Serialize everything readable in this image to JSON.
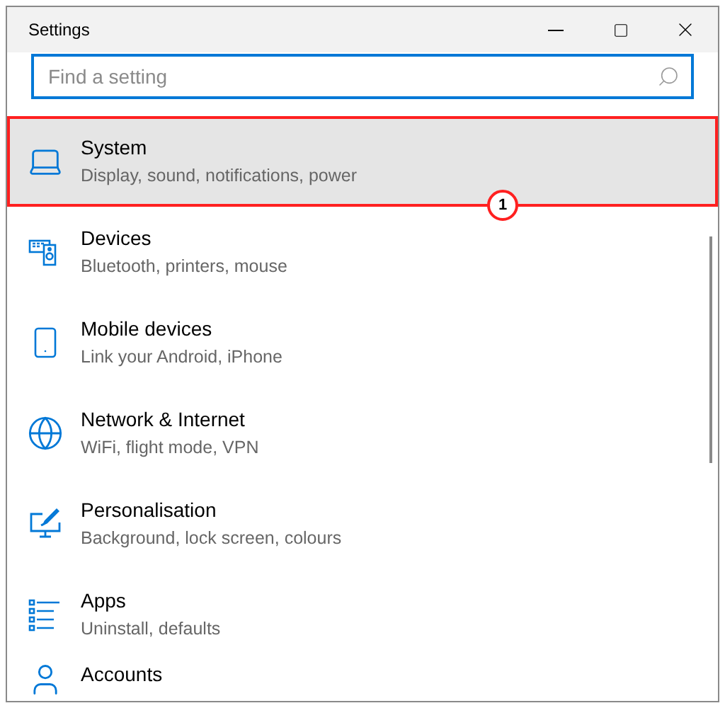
{
  "window": {
    "title": "Settings"
  },
  "search": {
    "placeholder": "Find a setting"
  },
  "items": [
    {
      "title": "System",
      "subtitle": "Display, sound, notifications, power",
      "selected": true,
      "callout": "1"
    },
    {
      "title": "Devices",
      "subtitle": "Bluetooth, printers, mouse",
      "selected": false
    },
    {
      "title": "Mobile devices",
      "subtitle": "Link your Android, iPhone",
      "selected": false
    },
    {
      "title": "Network & Internet",
      "subtitle": "WiFi, flight mode, VPN",
      "selected": false
    },
    {
      "title": "Personalisation",
      "subtitle": "Background, lock screen, colours",
      "selected": false
    },
    {
      "title": "Apps",
      "subtitle": "Uninstall, defaults",
      "selected": false
    },
    {
      "title": "Accounts",
      "selected": false
    }
  ]
}
